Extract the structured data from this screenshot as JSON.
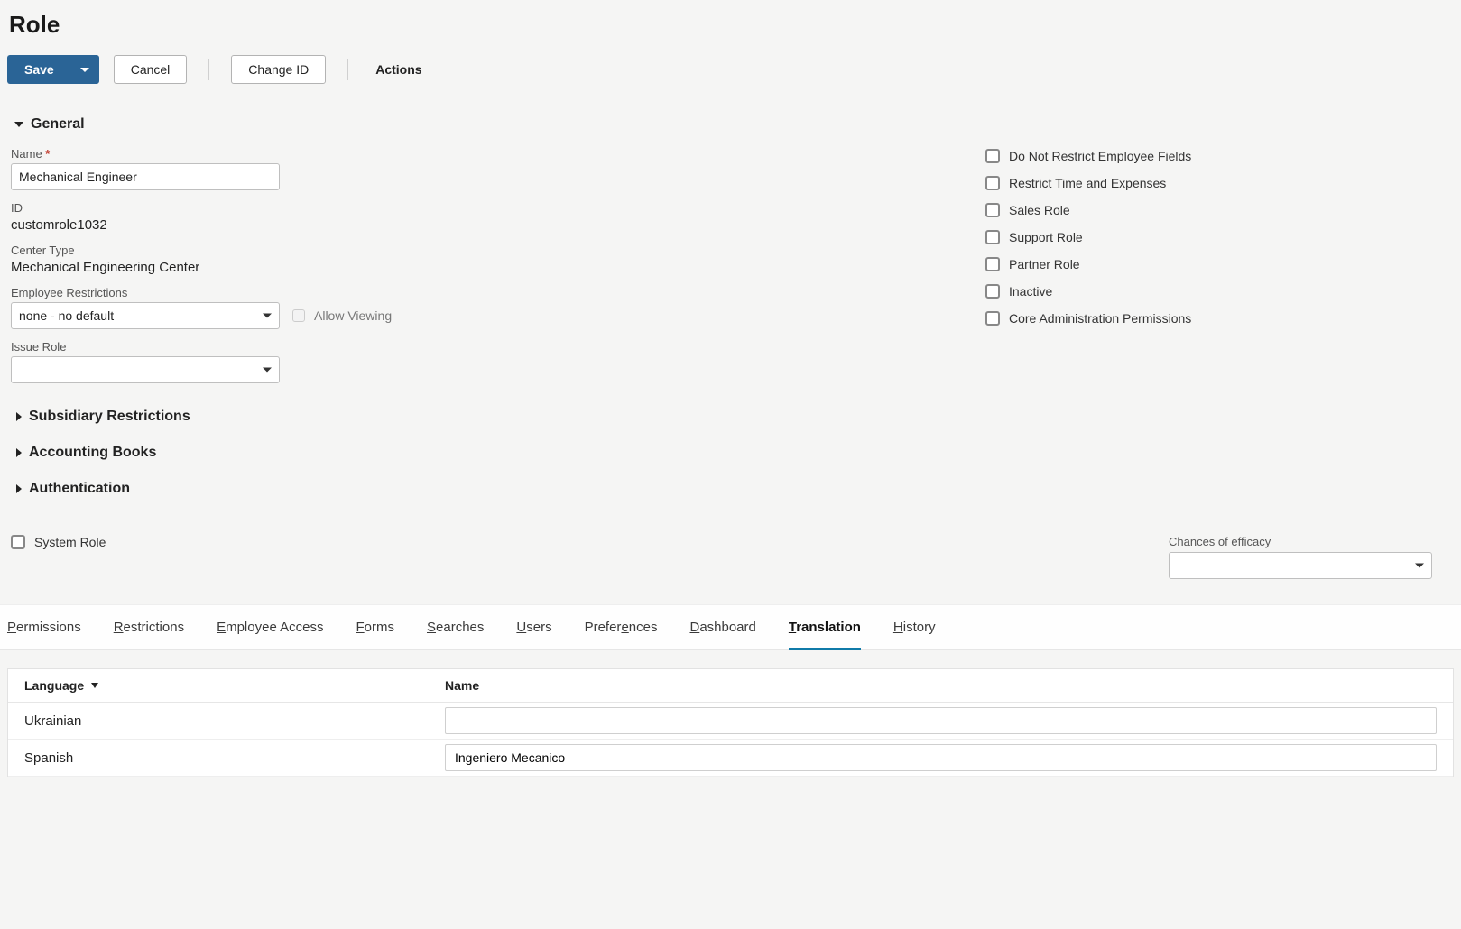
{
  "page": {
    "title": "Role"
  },
  "toolbar": {
    "save": "Save",
    "cancel": "Cancel",
    "change_id": "Change ID",
    "actions": "Actions"
  },
  "sections": {
    "general": "General",
    "subsidiary": "Subsidiary Restrictions",
    "accounting": "Accounting Books",
    "authentication": "Authentication"
  },
  "fields": {
    "name": {
      "label": "Name",
      "value": "Mechanical Engineer"
    },
    "id": {
      "label": "ID",
      "value": "customrole1032"
    },
    "center_type": {
      "label": "Center Type",
      "value": "Mechanical Engineering Center"
    },
    "employee_restrictions": {
      "label": "Employee Restrictions",
      "value": "none - no default"
    },
    "allow_viewing": {
      "label": "Allow Viewing"
    },
    "issue_role": {
      "label": "Issue Role",
      "value": ""
    },
    "system_role": {
      "label": "System Role"
    },
    "efficacy": {
      "label": "Chances of efficacy",
      "value": ""
    }
  },
  "checkboxes": [
    "Do Not Restrict Employee Fields",
    "Restrict Time and Expenses",
    "Sales Role",
    "Support Role",
    "Partner Role",
    "Inactive",
    "Core Administration Permissions"
  ],
  "tabs": [
    {
      "id": "permissions",
      "label": "Permissions",
      "u": 0,
      "active": false
    },
    {
      "id": "restrictions",
      "label": "Restrictions",
      "u": 0,
      "active": false
    },
    {
      "id": "employee-access",
      "label": "Employee Access",
      "u": 0,
      "active": false
    },
    {
      "id": "forms",
      "label": "Forms",
      "u": 0,
      "active": false
    },
    {
      "id": "searches",
      "label": "Searches",
      "u": 0,
      "active": false
    },
    {
      "id": "users",
      "label": "Users",
      "u": 0,
      "active": false
    },
    {
      "id": "preferences",
      "label": "Preferences",
      "u": 6,
      "active": false
    },
    {
      "id": "dashboard",
      "label": "Dashboard",
      "u": 0,
      "active": false
    },
    {
      "id": "translation",
      "label": "Translation",
      "u": 0,
      "active": true
    },
    {
      "id": "history",
      "label": "History",
      "u": 0,
      "active": false
    }
  ],
  "table": {
    "headers": {
      "language": "Language",
      "name": "Name"
    },
    "rows": [
      {
        "language": "Ukrainian",
        "name": ""
      },
      {
        "language": "Spanish",
        "name": "Ingeniero Mecanico"
      }
    ]
  }
}
